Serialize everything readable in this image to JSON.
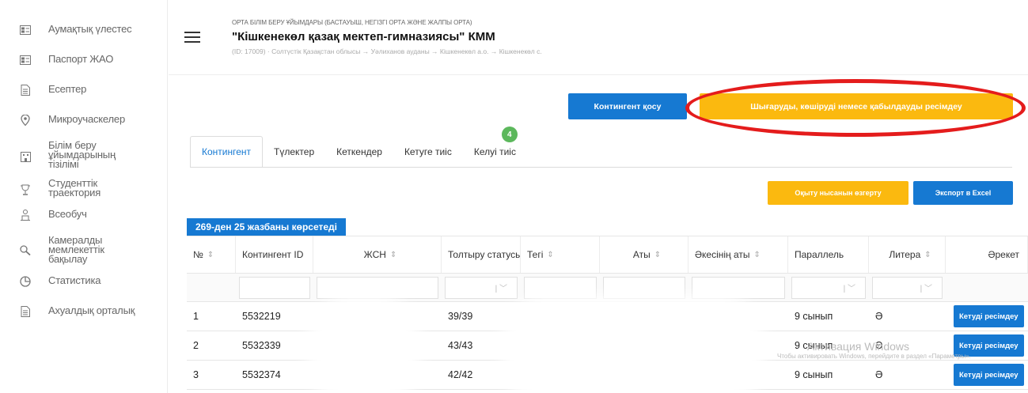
{
  "sidebar": {
    "items": [
      {
        "label": "Аумақтық үлестес",
        "icon": "grid-icon"
      },
      {
        "label": "Паспорт ЖАО",
        "icon": "grid-icon"
      },
      {
        "label": "Есептер",
        "icon": "document-icon"
      },
      {
        "label": "Микроучаскелер",
        "icon": "location-icon"
      },
      {
        "label": "Білім беру ұйымдарының тізілімі",
        "icon": "building-icon"
      },
      {
        "label": "Студенттік траектория",
        "icon": "trophy-icon"
      },
      {
        "label": "Всеобуч",
        "icon": "person-icon"
      },
      {
        "label": "Камералды мемлекеттік бақылау",
        "icon": "inspection-icon"
      },
      {
        "label": "Статистика",
        "icon": "chart-icon"
      },
      {
        "label": "Ахуалдық орталық",
        "icon": "document-icon"
      }
    ]
  },
  "header": {
    "org_type": "ОРТА БІЛІМ БЕРУ ҰЙЫМДАРЫ (БАСТАУЫШ, НЕГІЗГІ ОРТА ЖӘНЕ ЖАЛПЫ ОРТА)",
    "org_title": "\"Кішкенекөл қазақ мектеп-гимназиясы\" КММ",
    "org_path": "(ID: 17009) · Солтүстік Қазақстан облысы → Уәлиханов ауданы → Кішкенекөл а.о. → Кішкенекөл с."
  },
  "actions": {
    "add_contingent": "Контингент қосу",
    "formalize": "Шығаруды, көшіруді немесе қабылдауды ресімдеу",
    "change_edu_form": "Оқыту нысанын өзгерту",
    "export_excel": "Экспорт в Excel"
  },
  "tabs": [
    {
      "label": "Контингент",
      "active": true
    },
    {
      "label": "Түлектер",
      "active": false
    },
    {
      "label": "Кеткендер",
      "active": false
    },
    {
      "label": "Кетуге тиіс",
      "active": false
    },
    {
      "label": "Келуі тиіс",
      "active": false,
      "badge": "4"
    }
  ],
  "records_label": "269-ден 25 жазбаны көрсетеді",
  "table": {
    "headers": [
      "№",
      "Контингент ID",
      "ЖСН",
      "Толтыру статусы",
      "Тегі",
      "Аты",
      "Әкесінің аты",
      "Параллель",
      "Литера",
      "Әрекет"
    ],
    "rows": [
      {
        "num": "1",
        "id": "5532219",
        "fill": "39/39",
        "parallel": "9 сынып",
        "litera": "Ә",
        "action": "Кетуді ресімдеу"
      },
      {
        "num": "2",
        "id": "5532339",
        "fill": "43/43",
        "parallel": "9 сынып",
        "litera": "Ә",
        "action": "Кетуді ресімдеу"
      },
      {
        "num": "3",
        "id": "5532374",
        "fill": "42/42",
        "parallel": "9 сынып",
        "litera": "Ә",
        "action": "Кетуді ресімдеу"
      }
    ]
  },
  "watermark": {
    "title": "Активация Windows",
    "line": "Чтобы активировать Windows, перейдите в раздел «Параметры»."
  },
  "colors": {
    "primary": "#1679d2",
    "warning": "#fbb90f",
    "success": "#5cb85c",
    "highlight": "#e41c1c"
  }
}
